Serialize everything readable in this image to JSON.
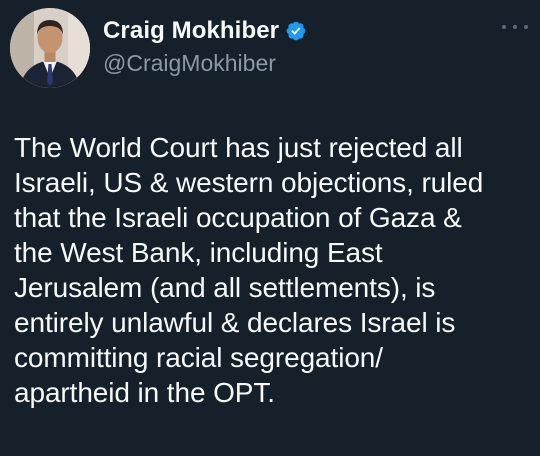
{
  "author": {
    "display_name": "Craig Mokhiber",
    "handle": "@CraigMokhiber",
    "verified": true,
    "avatar_icon": "profile-photo-icon"
  },
  "menu": {
    "icon": "more-horizontal-icon"
  },
  "tweet": {
    "text": "The World Court has just rejected all\nIsraeli, US & western objections, ruled\nthat the Israeli occupation of Gaza &\nthe West Bank, including East\nJerusalem (and all settlements), is\nentirely unlawful & declares Israel is\ncommitting racial segregation/\napartheid in the OPT."
  },
  "colors": {
    "background": "#15202b",
    "text": "#f7f9f9",
    "secondary_text": "#8b98a5",
    "verified_badge": "#1d9bf0"
  }
}
